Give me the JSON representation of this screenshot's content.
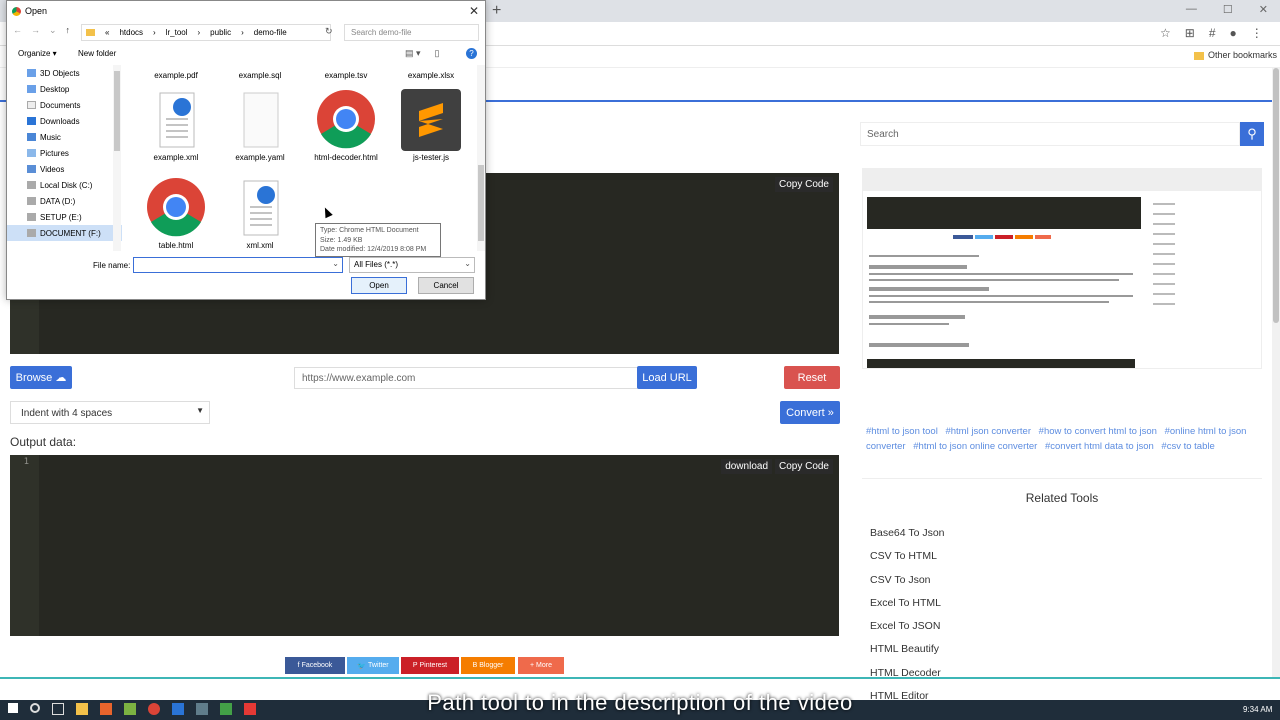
{
  "browser": {
    "new_tab": "+",
    "other_bookmarks": "Other bookmarks"
  },
  "editor": {
    "input_copy": "Copy Code",
    "output_download": "download",
    "output_copy": "Copy Code",
    "line1": "1"
  },
  "controls": {
    "browse": "Browse",
    "url_placeholder": "https://www.example.com",
    "load_url": "Load URL",
    "reset": "Reset",
    "indent": "Indent with 4 spaces",
    "convert": "Convert",
    "output_label": "Output data:"
  },
  "share": [
    "Facebook",
    "Twitter",
    "Pinterest",
    "Blogger",
    "More"
  ],
  "sidebar": {
    "search_placeholder": "Search",
    "tags": [
      "#html to json tool",
      "#html json converter",
      "#how to convert html to json",
      "#online html to json converter",
      "#html to json online converter",
      "#convert html data to json",
      "#csv to table"
    ],
    "related_title": "Related Tools",
    "related": [
      "Base64 To Json",
      "CSV To HTML",
      "CSV To Json",
      "Excel To HTML",
      "Excel To JSON",
      "HTML Beautify",
      "HTML Decoder",
      "HTML Editor"
    ]
  },
  "dialog": {
    "title": "Open",
    "path": [
      "htdocs",
      "lr_tool",
      "public",
      "demo-file"
    ],
    "search": "Search demo-file",
    "organize": "Organize ▾",
    "new_folder": "New folder",
    "tree": [
      "3D Objects",
      "Desktop",
      "Documents",
      "Downloads",
      "Music",
      "Pictures",
      "Videos",
      "Local Disk (C:)",
      "DATA (D:)",
      "SETUP (E:)",
      "DOCUMENT (F:)"
    ],
    "files_top": [
      "example.pdf",
      "example.sql",
      "example.tsv",
      "example.xlsx"
    ],
    "files": [
      "example.xml",
      "example.yaml",
      "html-decoder.html",
      "js-tester.js",
      "table.html",
      "xml.xml"
    ],
    "tooltip": [
      "Type: Chrome HTML Document",
      "Size: 1.49 KB",
      "Date modified: 12/4/2019 8:08 PM"
    ],
    "file_name_label": "File name:",
    "file_type": "All Files (*.*)",
    "open": "Open",
    "cancel": "Cancel"
  },
  "taskbar": {
    "clock": "9:34 AM"
  },
  "caption": "Path tool to in the description of the video",
  "colors": {
    "accent": "#3a6fd8",
    "reset": "#d9534f",
    "editor_bg": "#272822",
    "facebook": "#3b5998",
    "twitter": "#55acee",
    "pinterest": "#cb2027",
    "blogger": "#f57d00",
    "more": "#ef6a4b"
  }
}
